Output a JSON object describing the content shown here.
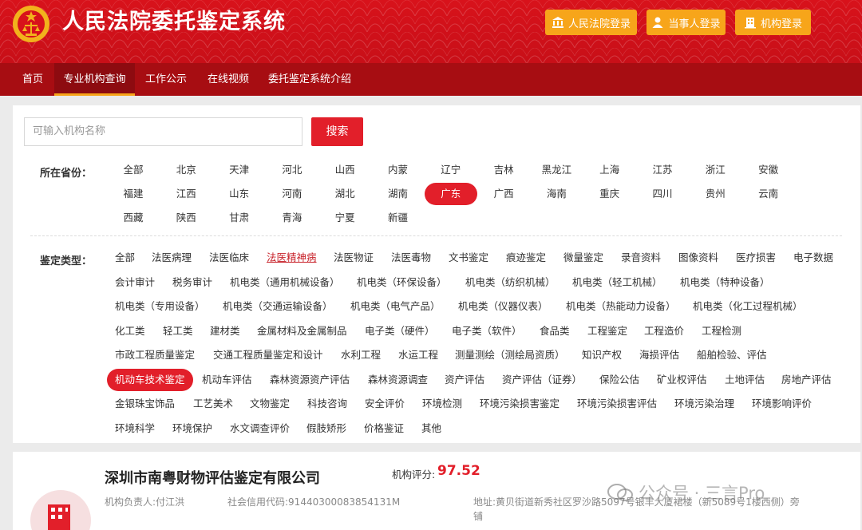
{
  "header": {
    "title": "人民法院委托鉴定系统",
    "login_buttons": [
      "人民法院登录",
      "当事人登录",
      "机构登录"
    ]
  },
  "nav": {
    "items": [
      "首页",
      "专业机构查询",
      "工作公示",
      "在线视频",
      "委托鉴定系统介绍"
    ],
    "active": "专业机构查询"
  },
  "search": {
    "placeholder": "可输入机构名称",
    "button": "搜索"
  },
  "province": {
    "label": "所在省份：",
    "items": [
      "全部",
      "北京",
      "天津",
      "河北",
      "山西",
      "内蒙",
      "辽宁",
      "吉林",
      "黑龙江",
      "上海",
      "江苏",
      "浙江",
      "安徽",
      "福建",
      "江西",
      "山东",
      "河南",
      "湖北",
      "湖南",
      "广东",
      "广西",
      "海南",
      "重庆",
      "四川",
      "贵州",
      "云南",
      "西藏",
      "陕西",
      "甘肃",
      "青海",
      "宁夏",
      "新疆"
    ],
    "selected": "广东"
  },
  "types": {
    "label": "鉴定类型：",
    "rows": [
      [
        "全部",
        "法医病理",
        "法医临床",
        "法医精神病",
        "法医物证",
        "法医毒物",
        "文书鉴定",
        "痕迹鉴定",
        "微量鉴定",
        "录音资料",
        "图像资料",
        "医疗损害",
        "电子数据"
      ],
      [
        "会计审计",
        "税务审计",
        "机电类（通用机械设备）",
        "机电类（环保设备）",
        "机电类（纺织机械）",
        "机电类（轻工机械）",
        "机电类（特种设备）"
      ],
      [
        "机电类（专用设备）",
        "机电类（交通运输设备）",
        "机电类（电气产品）",
        "机电类（仪器仪表）",
        "机电类（热能动力设备）",
        "机电类（化工过程机械）"
      ],
      [
        "化工类",
        "轻工类",
        "建材类",
        "金属材料及金属制品",
        "电子类（硬件）",
        "电子类（软件）",
        "食品类",
        "工程鉴定",
        "工程造价",
        "工程检测"
      ],
      [
        "市政工程质量鉴定",
        "交通工程质量鉴定和设计",
        "水利工程",
        "水运工程",
        "测量测绘（测绘局资质）",
        "知识产权",
        "海损评估",
        "船舶检验、评估"
      ],
      [
        "机动车技术鉴定",
        "机动车评估",
        "森林资源资产评估",
        "森林资源调查",
        "资产评估",
        "资产评估（证券）",
        "保险公估",
        "矿业权评估",
        "土地评估",
        "房地产评估"
      ],
      [
        "金银珠宝饰品",
        "工艺美术",
        "文物鉴定",
        "科技咨询",
        "安全评价",
        "环境检测",
        "环境污染损害鉴定",
        "环境污染损害评估",
        "环境污染治理",
        "环境影响评价"
      ],
      [
        "环境科学",
        "环境保护",
        "水文调查评价",
        "假肢矫形",
        "价格鉴证",
        "其他"
      ]
    ],
    "hover_link": "法医精神病",
    "selected": "机动车技术鉴定"
  },
  "result": {
    "org_name": "深圳市南粤财物评估鉴定有限公司",
    "score_label": "机构评分:",
    "score": "97.52",
    "leader": "机构负责人:付江洪",
    "credit_code": "社会信用代码:91440300083854131M",
    "address": "地址:黄贝街道新秀社区罗沙路5097号银丰大厦裙楼（新5089号1楼西侧）旁",
    "address_cont": "铺"
  },
  "watermark": "公众号 · 三言Pro",
  "colors": {
    "brand_red": "#d8121b",
    "nav_red": "#a70d12",
    "accent_orange": "#f7a51a",
    "active_red": "#e21f2a"
  }
}
